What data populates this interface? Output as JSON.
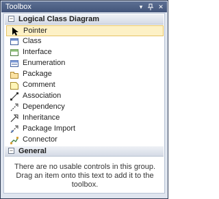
{
  "window": {
    "title": "Toolbox",
    "buttons": {
      "pin": "▾",
      "autohide": "⊣",
      "close": "✕"
    }
  },
  "groups": [
    {
      "title": "Logical Class Diagram",
      "expanded": true,
      "items": [
        {
          "label": "Pointer",
          "icon": "pointer-icon",
          "selected": true
        },
        {
          "label": "Class",
          "icon": "class-icon"
        },
        {
          "label": "Interface",
          "icon": "interface-icon"
        },
        {
          "label": "Enumeration",
          "icon": "enumeration-icon"
        },
        {
          "label": "Package",
          "icon": "package-icon"
        },
        {
          "label": "Comment",
          "icon": "comment-icon"
        },
        {
          "label": "Association",
          "icon": "association-icon"
        },
        {
          "label": "Dependency",
          "icon": "dependency-icon"
        },
        {
          "label": "Inheritance",
          "icon": "inheritance-icon"
        },
        {
          "label": "Package Import",
          "icon": "package-import-icon"
        },
        {
          "label": "Connector",
          "icon": "connector-icon"
        }
      ]
    },
    {
      "title": "General",
      "expanded": true,
      "empty_message": "There are no usable controls in this group. Drag an item onto this text to add it to the toolbox."
    }
  ],
  "colors": {
    "titlebar": "#4d5f84",
    "selection_fill": "#fdf1c6",
    "selection_border": "#e5c365",
    "group_header": "#dde2ea"
  }
}
